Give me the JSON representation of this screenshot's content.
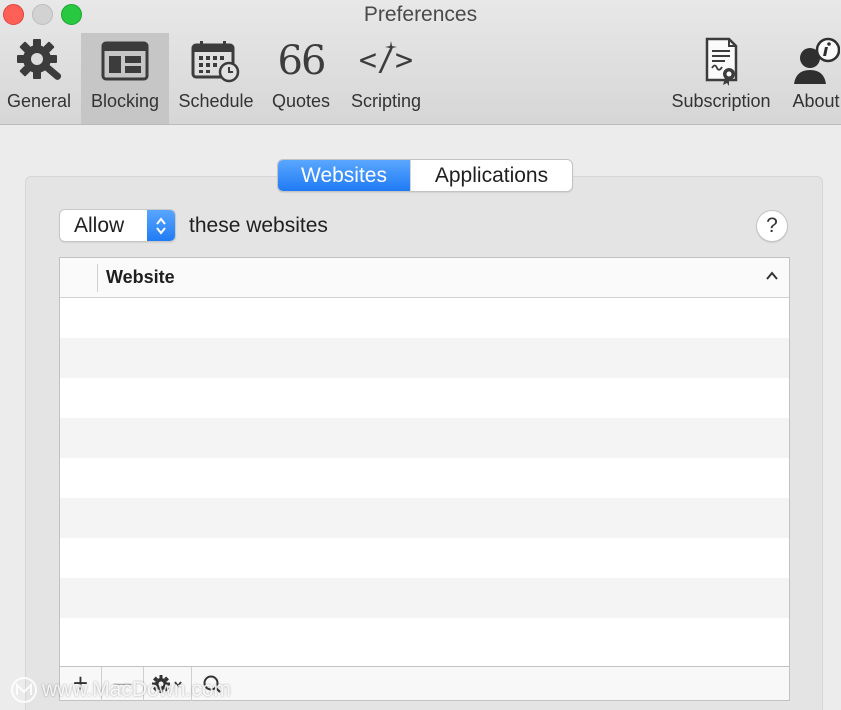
{
  "window": {
    "title": "Preferences"
  },
  "toolbar": {
    "items": [
      {
        "label": "General",
        "icon": "gear-wrench-icon"
      },
      {
        "label": "Blocking",
        "icon": "window-blocking-icon",
        "selected": true
      },
      {
        "label": "Schedule",
        "icon": "calendar-clock-icon"
      },
      {
        "label": "Quotes",
        "icon": "quote-icon"
      },
      {
        "label": "Scripting",
        "icon": "code-icon"
      },
      {
        "label": "Subscription",
        "icon": "certificate-icon"
      },
      {
        "label": "About",
        "icon": "person-info-icon"
      }
    ],
    "quotes_glyph": "66",
    "scripting_glyph": "</>"
  },
  "tabs": {
    "websites": "Websites",
    "applications": "Applications",
    "active": "Websites"
  },
  "filter": {
    "mode_value": "Allow",
    "suffix": "these websites"
  },
  "help": {
    "label": "?"
  },
  "table": {
    "column_header": "Website",
    "rows": []
  },
  "bottom_bar": {
    "add": "+",
    "remove": "—"
  },
  "watermark": {
    "text": "www.MacDown.com"
  },
  "colors": {
    "accent": "#1f7af4",
    "close": "#fe5f57",
    "zoom": "#28c840"
  }
}
